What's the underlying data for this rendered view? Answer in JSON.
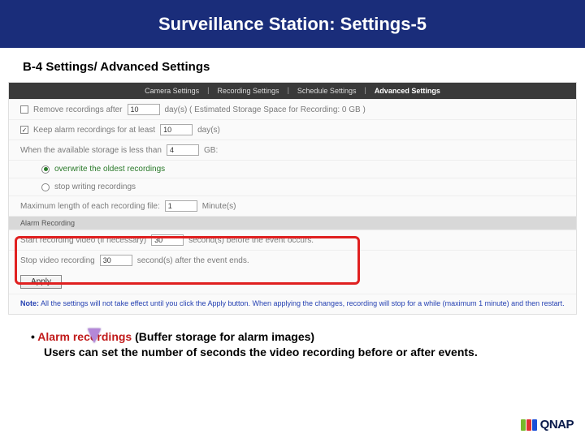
{
  "title": "Surveillance Station: Settings-5",
  "subtitle": "B-4 Settings/ Advanced Settings",
  "tabs": {
    "t1": "Camera Settings",
    "t2": "Recording Settings",
    "t3": "Schedule Settings",
    "t4": "Advanced Settings"
  },
  "settings": {
    "remove_label_a": "Remove recordings after",
    "remove_value": "10",
    "remove_label_b": "day(s)  ( Estimated Storage Space for Recording: 0 GB )",
    "keep_label_a": "Keep alarm recordings for at least",
    "keep_value": "10",
    "keep_label_b": "day(s)",
    "storage_label_a": "When the available storage is less than",
    "storage_value": "4",
    "storage_label_b": "GB:",
    "opt_overwrite": "overwrite the oldest recordings",
    "opt_stop": "stop writing recordings",
    "maxlen_label_a": "Maximum length of each recording file:",
    "maxlen_value": "1",
    "maxlen_label_b": "Minute(s)",
    "alarm_section": "Alarm Recording",
    "pre_label_a": "Start recording video (if necessary)",
    "pre_value": "30",
    "pre_label_b": "second(s) before the event occurs.",
    "post_label_a": "Stop video recording",
    "post_value": "30",
    "post_label_b": "second(s) after the event ends.",
    "apply": "Apply",
    "note_label": "Note:",
    "note_text": "All the settings will not take effect until you click the Apply button. When applying the changes, recording will stop for a while (maximum 1 minute) and then restart."
  },
  "bullet": {
    "lead": "Alarm recordings",
    "rest": " (Buffer storage for alarm images)",
    "line2": "Users can set the number of seconds the video recording before or after events."
  },
  "logo": "QNAP"
}
